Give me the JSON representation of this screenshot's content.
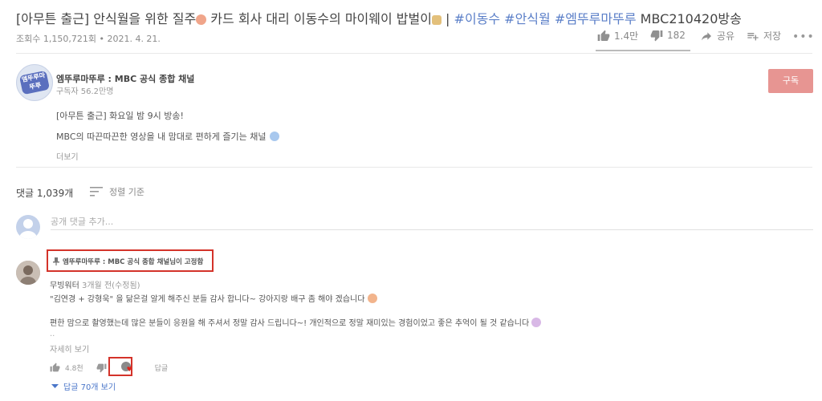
{
  "video": {
    "title_prefix": "[아무튼 출근] 안식월을 위한 질주",
    "title_mid": " 카드 회사 대리 이동수의 마이웨이 밥벌이",
    "title_sep": " | ",
    "title_tags": "#이동수 #안식월 #엠뚜루마뚜루",
    "title_suffix": " MBC210420방송",
    "views": "조회수 1,150,721회",
    "date": "2021. 4. 21.",
    "likes": "1.4만",
    "dislikes": "182",
    "share_label": "공유",
    "save_label": "저장"
  },
  "channel": {
    "name": "엠뚜루마뚜루 : MBC 공식 종합 채널",
    "subscribers": "구독자 56.2만명",
    "subscribe_label": "구독",
    "logo_text": "엠뚜루마뚜루",
    "desc_line1": "[아무튼 출근] 화요일 밤 9시 방송!",
    "desc_line2": "MBC의 따끈따끈한 영상을 내 맘대로 편하게 즐기는 채널",
    "more_label": "더보기"
  },
  "comments": {
    "count_label": "댓글 1,039개",
    "sort_label": "정렬 기준",
    "add_placeholder": "공개 댓글 추가...",
    "pinned": {
      "pinned_by": "엠뚜루마뚜루 : MBC 공식 종합 채널님이 고정함",
      "author": "무빙워터",
      "time": "3개월 전(수정됨)",
      "line1": "\"김연경 + 강형욱\" 을 닮은걸 알게 해주신 분들 감사 합니다~ 강아지랑 배구 좀 해야 겠습니다",
      "line2": "편한 맘으로 촬영했는데 많은 분들이 응원을 해 주셔서 정말 감사 드립니다~! 개인적으로 정말 재미있는 경험이었고 좋은 추억이 될 것 같습니다",
      "dots": "..",
      "more_label": "자세히 보기",
      "likes": "4.8천",
      "reply_label": "답글",
      "view_replies": "답글 70개 보기"
    }
  },
  "colors": {
    "accent_red": "#d4332a",
    "link_blue": "#4a76c9",
    "subscribe_bg": "#e79592"
  }
}
